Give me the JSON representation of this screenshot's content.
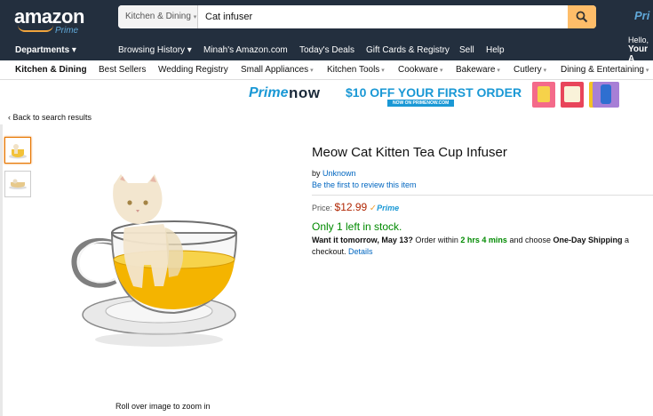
{
  "header": {
    "logo_text": "amazon",
    "logo_sub": "Prime",
    "search_category": "Kitchen & Dining",
    "search_value": "Cat infuser",
    "prime_right": "Pri",
    "hello_line1": "Hello,",
    "hello_line2": "Your A"
  },
  "nav": {
    "departments": "Departments",
    "items": [
      "Browsing History",
      "Minah's Amazon.com",
      "Today's Deals",
      "Gift Cards & Registry",
      "Sell",
      "Help"
    ]
  },
  "subnav": {
    "items": [
      "Kitchen & Dining",
      "Best Sellers",
      "Wedding Registry",
      "Small Appliances",
      "Kitchen Tools",
      "Cookware",
      "Bakeware",
      "Cutlery",
      "Dining & Entertaining"
    ]
  },
  "banner": {
    "prime": "Prime",
    "now": "now",
    "offer": "$10 OFF YOUR FIRST ORDER",
    "cta": "NOW ON PRIMENOW.COM"
  },
  "product": {
    "back_link": "‹ Back to search results",
    "title": "Meow Cat Kitten Tea Cup Infuser",
    "by_label": "by",
    "brand": "Unknown",
    "review_link": "Be the first to review this item",
    "price_label": "Price:",
    "price": "$12.99",
    "prime_label": "Prime",
    "stock": "Only 1 left in stock.",
    "ship_want": "Want it tomorrow, May 13?",
    "ship_order": "Order within",
    "ship_time": "2 hrs 4 mins",
    "ship_choose": "and choose",
    "ship_oneday": "One-Day Shipping",
    "ship_at": "a",
    "ship_checkout": "checkout.",
    "details_link": "Details",
    "rollover": "Roll over image to zoom in"
  },
  "colors": {
    "header_bg": "#232f3e",
    "search_button": "#febd69",
    "price": "#b12704",
    "stock_green": "#008a00",
    "link_blue": "#0066c0"
  }
}
